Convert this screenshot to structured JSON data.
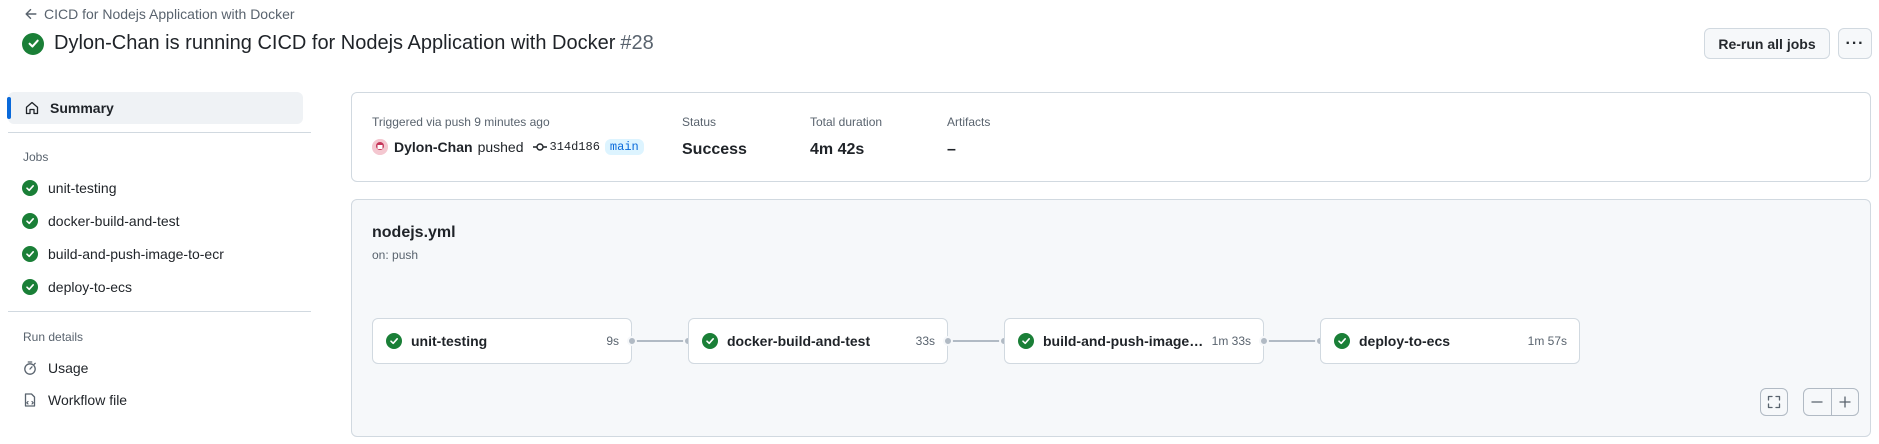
{
  "header": {
    "back_label": "CICD for Nodejs Application with Docker",
    "title": "Dylon-Chan is running CICD for Nodejs Application with Docker",
    "run_number": "#28",
    "rerun_label": "Re-run all jobs",
    "more_label": "···"
  },
  "sidebar": {
    "summary_label": "Summary",
    "jobs_heading": "Jobs",
    "jobs": [
      "unit-testing",
      "docker-build-and-test",
      "build-and-push-image-to-ecr",
      "deploy-to-ecs"
    ],
    "run_details_heading": "Run details",
    "usage_label": "Usage",
    "workflow_file_label": "Workflow file"
  },
  "summary": {
    "triggered_label": "Triggered via push 9 minutes ago",
    "actor": "Dylon-Chan",
    "action": "pushed",
    "commit": "314d186",
    "branch": "main",
    "status_label": "Status",
    "status_value": "Success",
    "duration_label": "Total duration",
    "duration_value": "4m 42s",
    "artifacts_label": "Artifacts",
    "artifacts_value": "–"
  },
  "graph": {
    "workflow_file": "nodejs.yml",
    "trigger": "on: push",
    "jobs": [
      {
        "name": "unit-testing",
        "duration": "9s"
      },
      {
        "name": "docker-build-and-test",
        "duration": "33s"
      },
      {
        "name": "build-and-push-image-t...",
        "duration": "1m 33s"
      },
      {
        "name": "deploy-to-ecs",
        "duration": "1m 57s"
      }
    ]
  },
  "colors": {
    "success": "#1a7f37",
    "accent": "#0969da"
  }
}
